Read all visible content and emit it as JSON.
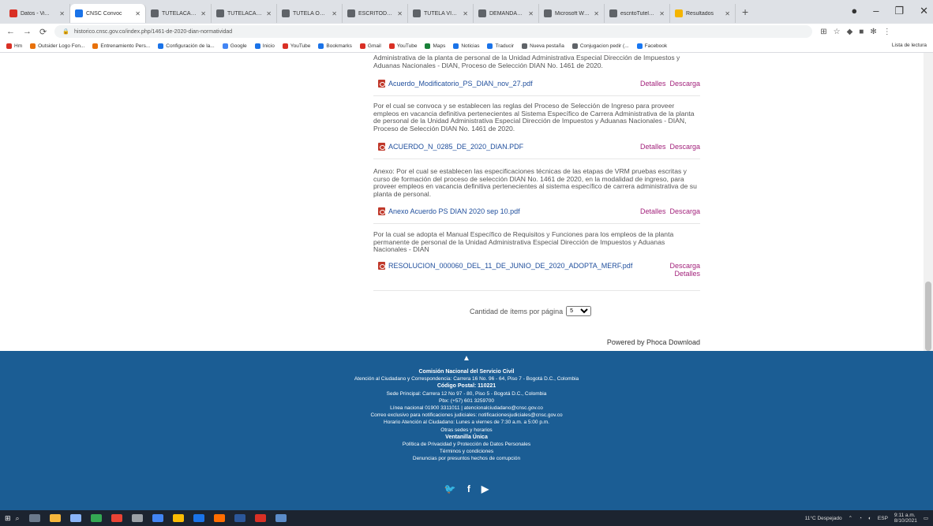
{
  "browser": {
    "tabs": [
      {
        "label": "Datos - Vi...",
        "color": "#d93025"
      },
      {
        "label": "CNSC Convoc",
        "color": "#1a73e8",
        "active": true
      },
      {
        "label": "TUTELACAMB",
        "color": "#5f6368"
      },
      {
        "label": "TUTELACAMPO",
        "color": "#5f6368"
      },
      {
        "label": "TUTELA OSCAR",
        "color": "#5f6368"
      },
      {
        "label": "ESCRITODETUT",
        "color": "#5f6368"
      },
      {
        "label": "TUTELA VICTO",
        "color": "#5f6368"
      },
      {
        "label": "DEMANDA_ECI",
        "color": "#5f6368"
      },
      {
        "label": "Microsoft Word",
        "color": "#5f6368"
      },
      {
        "label": "escritoTutela_ECI",
        "color": "#5f6368"
      },
      {
        "label": "Resultados",
        "color": "#f4b400"
      }
    ],
    "url": "historico.cnsc.gov.co/index.php/1461-de-2020-dian-normatividad",
    "bookmarks": [
      {
        "label": "Hm",
        "color": "#d93025"
      },
      {
        "label": "Outsider Logo Fon...",
        "color": "#e8710a"
      },
      {
        "label": "Entrenamiento Pers...",
        "color": "#e8710a"
      },
      {
        "label": "Configuración de la...",
        "color": "#1a73e8"
      },
      {
        "label": "Google",
        "color": "#4285f4"
      },
      {
        "label": "Inicio",
        "color": "#1a73e8"
      },
      {
        "label": "YouTube",
        "color": "#d93025"
      },
      {
        "label": "Bookmarks",
        "color": "#1a73e8"
      },
      {
        "label": "Gmail",
        "color": "#d93025"
      },
      {
        "label": "YouTube",
        "color": "#d93025"
      },
      {
        "label": "Maps",
        "color": "#188038"
      },
      {
        "label": "Noticias",
        "color": "#1a73e8"
      },
      {
        "label": "Traducir",
        "color": "#1a73e8"
      },
      {
        "label": "Nueva pestaña",
        "color": "#5f6368"
      },
      {
        "label": "Conjugacion pedir (...",
        "color": "#5f6368"
      },
      {
        "label": "Facebook",
        "color": "#1877f2"
      }
    ],
    "reading_list": "Lista de lectura"
  },
  "documents": [
    {
      "description": "Administrativa de la planta de personal de la Unidad Administrativa Especial Dirección de Impuestos y Aduanas Nacionales - DIAN, Proceso de Selección DIAN No. 1461 de 2020.",
      "file": "Acuerdo_Modificatorio_PS_DIAN_nov_27.pdf",
      "details": "Detalles",
      "download": "Descarga"
    },
    {
      "description": "Por el cual se convoca y se establecen las reglas del Proceso de Selección de Ingreso para proveer empleos en vacancia definitiva pertenecientes al Sistema Específico de Carrera Administrativa de la planta de personal de la Unidad Administrativa Especial Dirección de Impuestos y Aduanas Nacionales - DIAN, Proceso de Selección DIAN No. 1461 de 2020.",
      "file": "ACUERDO_N_0285_DE_2020_DIAN.PDF",
      "details": "Detalles",
      "download": "Descarga"
    },
    {
      "description": "Anexo: Por el cual se establecen las especificaciones técnicas de las etapas de VRM pruebas escritas y curso de formación del proceso de selección DIAN No. 1461 de 2020, en la modalidad de ingreso, para proveer empleos en vacancia definitiva pertenecientes al sistema específico de carrera administrativa de su planta de personal.",
      "file": "Anexo Acuerdo PS DIAN 2020 sep 10.pdf",
      "details": "Detalles",
      "download": "Descarga"
    },
    {
      "description": "Por la cual se adopta el Manual Específico de Requisitos y Funciones para los empleos de la planta permanente de personal de la Unidad Administrativa Especial Dirección de Impuestos y Aduanas Nacionales - DIAN",
      "file": "RESOLUCION_000060_DEL_11_DE_JUNIO_DE_2020_ADOPTA_MERF.pdf",
      "details": "Detalles",
      "download": "Descarga"
    }
  ],
  "pagination": {
    "label": "Cantidad de ítems por página",
    "value": "5"
  },
  "powered_by": "Powered by Phoca Download",
  "footer": {
    "org": "Comisión Nacional del Servicio Civil",
    "lines": [
      "Atención al Ciudadano y Correspondencia: Carrera 16 No. 96 - 64, Piso 7 - Bogotá D.C., Colombia",
      "Código Postal: 110221",
      "Sede Principal: Carrera 12 No 97 - 80, Piso 5 - Bogotá D.C., Colombia",
      "Pbx: (+57) 601 3259700",
      "Línea nacional 01900 3311011 | atencionalciudadano@cnsc.gov.co",
      "Correo exclusivo para notificaciones judiciales: notificacionesjudiciales@cnsc.gov.co",
      "Horario Atención al Ciudadano: Lunes a viernes de 7:30 a.m. a 5:00 p.m.",
      "Otras sedes y horarios",
      "Ventanilla Única",
      "Política de Privacidad y Protección de Datos Personales",
      "Términos y condiciones",
      "Denuncias por presuntos hechos de corrupción"
    ],
    "social": [
      "twitter-icon",
      "facebook-icon",
      "youtube-icon"
    ]
  },
  "taskbar": {
    "weather": "11°C  Despejado",
    "lang": "ESP",
    "time": "9:11 a.m.",
    "date": "8/10/2021"
  }
}
